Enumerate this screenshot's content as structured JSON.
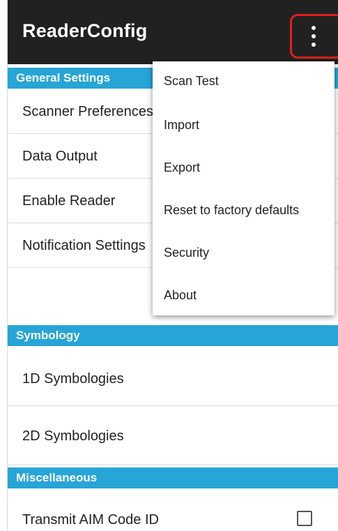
{
  "app_bar": {
    "title": "ReaderConfig",
    "overflow_icon": "more-vert-icon",
    "highlight_color": "#e0201c",
    "background": "#212121"
  },
  "accent_color": "#26a5d6",
  "sections": {
    "general": {
      "header": "General Settings",
      "items": [
        "Scanner Preferences",
        "Data Output",
        "Enable Reader",
        "Notification Settings"
      ]
    },
    "symbology": {
      "header": "Symbology",
      "items": [
        "1D Symbologies",
        "2D Symbologies"
      ]
    },
    "misc": {
      "header": "Miscellaneous",
      "items": [
        "Transmit AIM Code ID"
      ],
      "transmit_aim_checked": false
    }
  },
  "overflow_menu": {
    "items": [
      "Scan Test",
      "Import",
      "Export",
      "Reset to factory defaults",
      "Security",
      "About"
    ]
  }
}
